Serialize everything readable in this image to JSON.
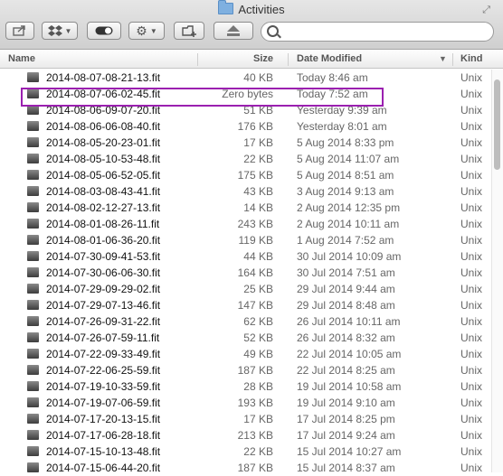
{
  "window": {
    "title": "Activities"
  },
  "toolbar": {
    "back_icon": "share-icon",
    "dropbox_icon": "dropbox-icon",
    "toggle_icon": "toggle-icon",
    "gear_icon": "gear-icon",
    "new_folder_icon": "new-folder-icon",
    "eject_icon": "eject-icon",
    "search_value": ""
  },
  "columns": {
    "name": "Name",
    "size": "Size",
    "date": "Date Modified",
    "kind": "Kind"
  },
  "files": [
    {
      "name": "2014-08-07-08-21-13.fit",
      "size": "40 KB",
      "date": "Today 8:46 am",
      "kind": "Unix"
    },
    {
      "name": "2014-08-07-06-02-45.fit",
      "size": "Zero bytes",
      "date": "Today 7:52 am",
      "kind": "Unix"
    },
    {
      "name": "2014-08-06-09-07-20.fit",
      "size": "51 KB",
      "date": "Yesterday 9:39 am",
      "kind": "Unix"
    },
    {
      "name": "2014-08-06-06-08-40.fit",
      "size": "176 KB",
      "date": "Yesterday 8:01 am",
      "kind": "Unix"
    },
    {
      "name": "2014-08-05-20-23-01.fit",
      "size": "17 KB",
      "date": "5 Aug 2014 8:33 pm",
      "kind": "Unix"
    },
    {
      "name": "2014-08-05-10-53-48.fit",
      "size": "22 KB",
      "date": "5 Aug 2014 11:07 am",
      "kind": "Unix"
    },
    {
      "name": "2014-08-05-06-52-05.fit",
      "size": "175 KB",
      "date": "5 Aug 2014 8:51 am",
      "kind": "Unix"
    },
    {
      "name": "2014-08-03-08-43-41.fit",
      "size": "43 KB",
      "date": "3 Aug 2014 9:13 am",
      "kind": "Unix"
    },
    {
      "name": "2014-08-02-12-27-13.fit",
      "size": "14 KB",
      "date": "2 Aug 2014 12:35 pm",
      "kind": "Unix"
    },
    {
      "name": "2014-08-01-08-26-11.fit",
      "size": "243 KB",
      "date": "2 Aug 2014 10:11 am",
      "kind": "Unix"
    },
    {
      "name": "2014-08-01-06-36-20.fit",
      "size": "119 KB",
      "date": "1 Aug 2014 7:52 am",
      "kind": "Unix"
    },
    {
      "name": "2014-07-30-09-41-53.fit",
      "size": "44 KB",
      "date": "30 Jul 2014 10:09 am",
      "kind": "Unix"
    },
    {
      "name": "2014-07-30-06-06-30.fit",
      "size": "164 KB",
      "date": "30 Jul 2014 7:51 am",
      "kind": "Unix"
    },
    {
      "name": "2014-07-29-09-29-02.fit",
      "size": "25 KB",
      "date": "29 Jul 2014 9:44 am",
      "kind": "Unix"
    },
    {
      "name": "2014-07-29-07-13-46.fit",
      "size": "147 KB",
      "date": "29 Jul 2014 8:48 am",
      "kind": "Unix"
    },
    {
      "name": "2014-07-26-09-31-22.fit",
      "size": "62 KB",
      "date": "26 Jul 2014 10:11 am",
      "kind": "Unix"
    },
    {
      "name": "2014-07-26-07-59-11.fit",
      "size": "52 KB",
      "date": "26 Jul 2014 8:32 am",
      "kind": "Unix"
    },
    {
      "name": "2014-07-22-09-33-49.fit",
      "size": "49 KB",
      "date": "22 Jul 2014 10:05 am",
      "kind": "Unix"
    },
    {
      "name": "2014-07-22-06-25-59.fit",
      "size": "187 KB",
      "date": "22 Jul 2014 8:25 am",
      "kind": "Unix"
    },
    {
      "name": "2014-07-19-10-33-59.fit",
      "size": "28 KB",
      "date": "19 Jul 2014 10:58 am",
      "kind": "Unix"
    },
    {
      "name": "2014-07-19-07-06-59.fit",
      "size": "193 KB",
      "date": "19 Jul 2014 9:10 am",
      "kind": "Unix"
    },
    {
      "name": "2014-07-17-20-13-15.fit",
      "size": "17 KB",
      "date": "17 Jul 2014 8:25 pm",
      "kind": "Unix"
    },
    {
      "name": "2014-07-17-06-28-18.fit",
      "size": "213 KB",
      "date": "17 Jul 2014 9:24 am",
      "kind": "Unix"
    },
    {
      "name": "2014-07-15-10-13-48.fit",
      "size": "22 KB",
      "date": "15 Jul 2014 10:27 am",
      "kind": "Unix"
    },
    {
      "name": "2014-07-15-06-44-20.fit",
      "size": "187 KB",
      "date": "15 Jul 2014 8:37 am",
      "kind": "Unix"
    }
  ]
}
